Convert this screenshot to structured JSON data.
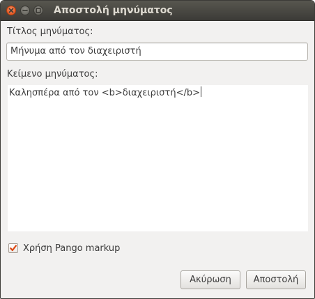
{
  "window": {
    "title": "Αποστολή μηνύματος"
  },
  "form": {
    "title_label": "Τίτλος μηνύματος:",
    "title_value": "Μήνυμα από τον διαχειριστή",
    "body_label": "Κείμενο μηνύματος:",
    "body_value": "Καλησπέρα από τον <b>διαχειριστή</b>",
    "pango_label": "Χρήση Pango markup",
    "pango_checked": true
  },
  "buttons": {
    "cancel": "Ακύρωση",
    "send": "Αποστολή"
  },
  "colors": {
    "close_button": "#de4a14",
    "titlebar": "#3c3b37",
    "checkmark": "#dd4814"
  }
}
